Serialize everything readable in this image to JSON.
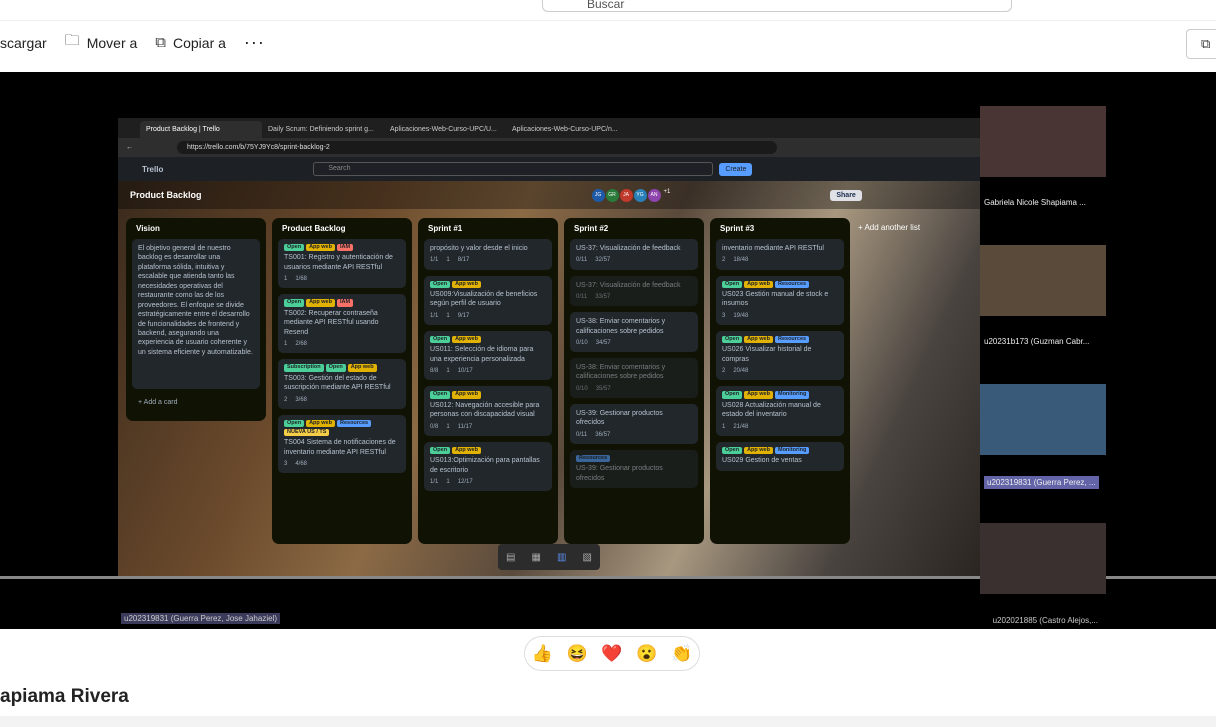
{
  "app": {
    "search_label": "Buscar"
  },
  "toolbar": {
    "download": "scargar",
    "move": "Mover a",
    "copy": "Copiar a",
    "more": "···"
  },
  "browser": {
    "tabs": [
      "Product Backlog | Trello",
      "Daily Scrum: Definiendo sprint g...",
      "Aplicaciones-Web-Curso-UPC/U...",
      "Aplicaciones-Web-Curso-UPC/n..."
    ],
    "url": "https://trello.com/b/75YJ9Yc8/sprint-backlog-2"
  },
  "trello": {
    "logo": "Trello",
    "search": "Search",
    "create": "Create",
    "board": "Product Backlog",
    "avatars": [
      "JG",
      "GR",
      "JA",
      "YG",
      "AN"
    ],
    "avatar_more": "+1",
    "share": "Share",
    "filter_tip": "Filter cards",
    "add_list": "+ Add another list"
  },
  "lists": [
    {
      "title": "Vision",
      "cards": [
        {
          "labels": [],
          "text": "El objetivo general de nuestro backlog es desarrollar una plataforma sólida, intuitiva y escalable que atienda tanto las necesidades operativas del restaurante como las de los proveedores. El enfoque se divide estratégicamente entre el desarrollo de funcionalidades de frontend y backend, asegurando una experiencia de usuario coherente y un sistema eficiente y automatizable.",
          "meta": []
        }
      ],
      "add": "+ Add a card"
    },
    {
      "title": "Product Backlog",
      "cards": [
        {
          "labels": [
            "Open",
            "App web",
            "IAM"
          ],
          "text": "TS001: Registro y autenticación de usuarios mediante API RESTful",
          "meta": [
            "1",
            "1/68"
          ]
        },
        {
          "labels": [
            "Open",
            "App web",
            "IAM"
          ],
          "text": "TS002: Recuperar contraseña mediante API RESTful usando Resend",
          "meta": [
            "1",
            "2/68"
          ]
        },
        {
          "labels": [
            "Subscription",
            "Open",
            "App web"
          ],
          "text": "TS003: Gestión del estado de suscripción mediante API RESTful",
          "meta": [
            "2",
            "3/68"
          ]
        },
        {
          "labels": [
            "Open",
            "App web",
            "Resources",
            "NUEVA US / TS"
          ],
          "text": "TS004 Sistema de notificaciones de inventario mediante API RESTful",
          "meta": [
            "3",
            "4/68"
          ]
        }
      ],
      "add": "+ Add a card"
    },
    {
      "title": "Sprint #1",
      "cards": [
        {
          "labels": [],
          "text": "propósito y valor desde el inicio",
          "meta": [
            "1/1",
            "1",
            "8/17"
          ]
        },
        {
          "labels": [
            "Open",
            "App web"
          ],
          "text": "US009:Visualización de beneficios según perfil de usuario",
          "meta": [
            "1/1",
            "1",
            "9/17"
          ]
        },
        {
          "labels": [
            "Open",
            "App web"
          ],
          "text": "US011: Selección de idioma para una experiencia personalizada",
          "meta": [
            "8/8",
            "1",
            "10/17"
          ]
        },
        {
          "labels": [
            "Open",
            "App web"
          ],
          "text": "US012: Navegación accesible para personas con discapacidad visual",
          "meta": [
            "0/8",
            "1",
            "11/17"
          ]
        },
        {
          "labels": [
            "Open",
            "App web"
          ],
          "text": "US013:Optimización para pantallas de escritorio",
          "meta": [
            "1/1",
            "1",
            "12/17"
          ]
        }
      ],
      "add": "+ Add a card"
    },
    {
      "title": "Sprint #2",
      "cards": [
        {
          "labels": [],
          "text": "US-37: Visualización de feedback",
          "meta": [
            "0/11",
            "32/57"
          ]
        },
        {
          "labels": [],
          "text": "US-37: Visualización de feedback",
          "meta": [
            "0/11",
            "33/57"
          ]
        },
        {
          "labels": [],
          "text": "US-38: Enviar comentarios y calificaciones sobre pedidos",
          "meta": [
            "0/10",
            "34/57"
          ]
        },
        {
          "labels": [],
          "text": "US-38: Enviar comentarios y calificaciones sobre pedidos",
          "meta": [
            "0/10",
            "35/57"
          ]
        },
        {
          "labels": [],
          "text": "US-39: Gestionar productos ofrecidos",
          "meta": [
            "0/11",
            "36/57"
          ]
        },
        {
          "labels": [
            "Resources"
          ],
          "text": "US-39: Gestionar productos ofrecidos",
          "meta": []
        }
      ],
      "add": "+ Add a card"
    },
    {
      "title": "Sprint #3",
      "cards": [
        {
          "labels": [],
          "text": "inventario mediante API RESTful",
          "meta": [
            "2",
            "18/48"
          ]
        },
        {
          "labels": [
            "Open",
            "App web",
            "Resources"
          ],
          "text": "US023 Gestión manual de stock e insumos",
          "meta": [
            "3",
            "19/48"
          ]
        },
        {
          "labels": [
            "Open",
            "App web",
            "Resources"
          ],
          "text": "US026 Visualizar historial de compras",
          "meta": [
            "2",
            "20/48"
          ]
        },
        {
          "labels": [
            "Open",
            "App web",
            "Monitoring"
          ],
          "text": "US028 Actualización manual de estado del inventario",
          "meta": [
            "1",
            "21/48"
          ]
        },
        {
          "labels": [
            "Open",
            "App web",
            "Monitoring"
          ],
          "text": "US029 Gestion de ventas",
          "meta": []
        }
      ],
      "add": "+ Add a card"
    }
  ],
  "participants": [
    "Gabriela Nicole Shapiama ...",
    "u20231b173 (Guzman Cabr...",
    "u202319831 (Guerra Perez, ...",
    ""
  ],
  "speaker_label": "u202319831 (Guerra Perez, Jose Jahaziel)",
  "corner_label": "u202021885 (Castro Alejos,...",
  "reactions": [
    "👍",
    "😆",
    "❤️",
    "😮",
    "👏"
  ],
  "presenter": "apiama Rivera",
  "colors": {
    "open": "#4bce97",
    "appweb": "#e2b203",
    "iam": "#f87168",
    "resources": "#579dff",
    "subscription": "#4bce97",
    "monitoring": "#579dff",
    "nueva": "#f5cd47"
  }
}
